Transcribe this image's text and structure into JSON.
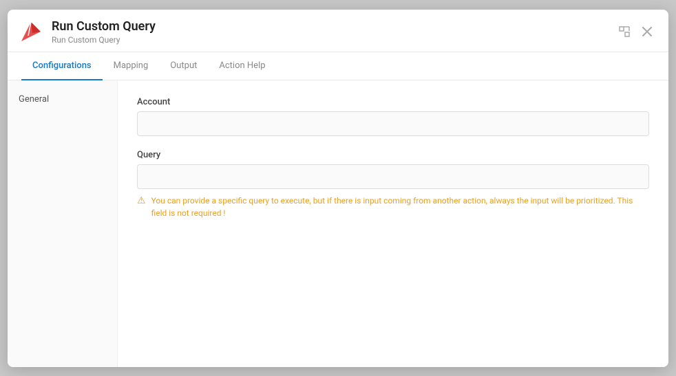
{
  "modal": {
    "title": "Run Custom Query",
    "subtitle": "Run Custom Query",
    "expand_label": "⛶",
    "close_label": "✕"
  },
  "tabs": [
    {
      "id": "configurations",
      "label": "Configurations",
      "active": true
    },
    {
      "id": "mapping",
      "label": "Mapping",
      "active": false
    },
    {
      "id": "output",
      "label": "Output",
      "active": false
    },
    {
      "id": "action-help",
      "label": "Action Help",
      "active": false
    }
  ],
  "sidebar": {
    "items": [
      {
        "id": "general",
        "label": "General"
      }
    ]
  },
  "form": {
    "account_label": "Account",
    "account_placeholder": "",
    "query_label": "Query",
    "query_placeholder": "",
    "hint_text": "You can provide a specific query to execute, but if there is input coming from another action, always the input will be prioritized. This field is not required !"
  },
  "icons": {
    "hint": "⚠",
    "expand": "⛶",
    "close": "✕"
  }
}
